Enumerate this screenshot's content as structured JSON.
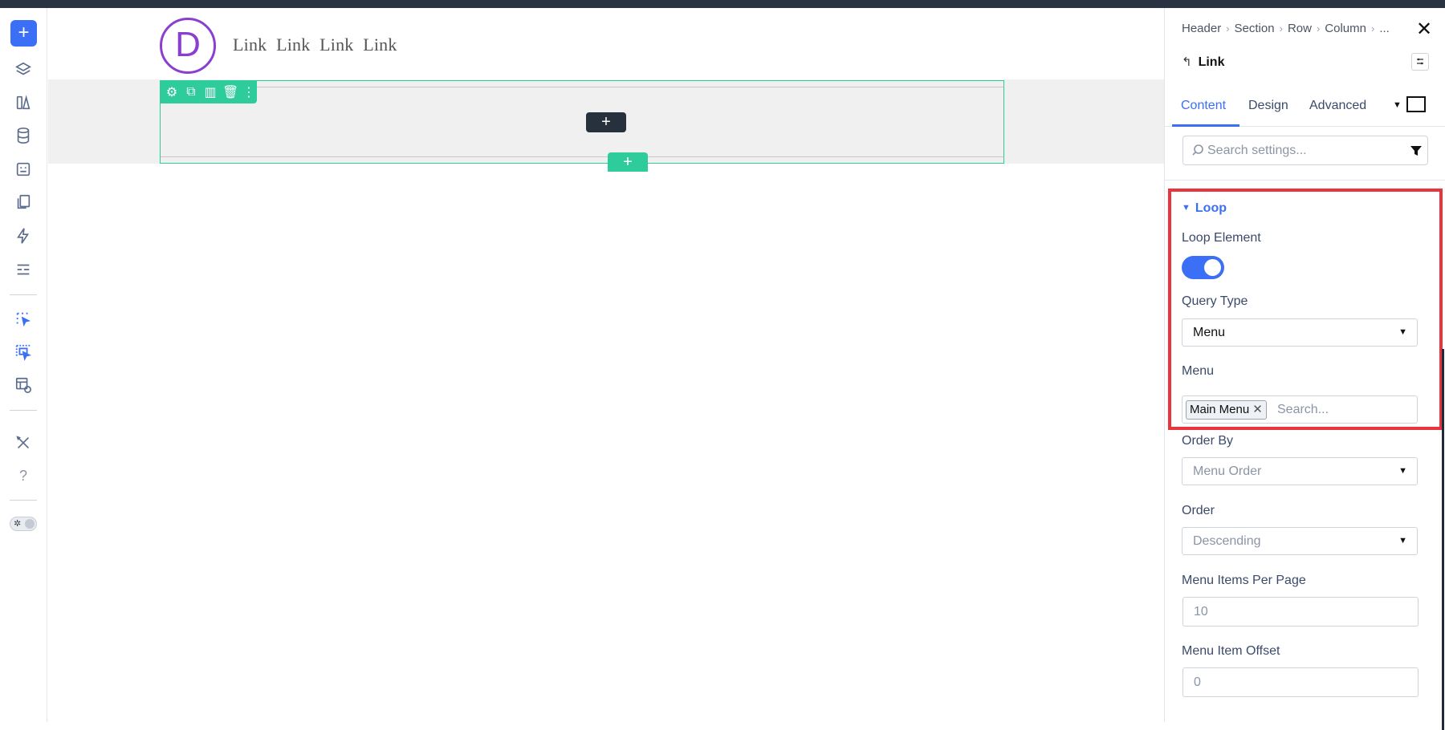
{
  "sidebar": {
    "add_label": "+",
    "items": [
      {
        "icon": "layers-icon"
      },
      {
        "icon": "library-icon"
      },
      {
        "icon": "database-icon"
      },
      {
        "icon": "form-icon"
      },
      {
        "icon": "pages-icon"
      },
      {
        "icon": "lightning-icon"
      },
      {
        "icon": "list-icon"
      },
      {
        "icon": "select-element-icon"
      },
      {
        "icon": "select-multiple-icon"
      },
      {
        "icon": "layout-preview-icon"
      },
      {
        "icon": "tools-icon"
      },
      {
        "icon": "help-icon",
        "label": "?"
      },
      {
        "icon": "theme-toggle-icon"
      }
    ]
  },
  "canvas": {
    "logo_letter": "D",
    "nav_links": [
      "Link",
      "Link",
      "Link",
      "Link"
    ],
    "add_module_label": "+",
    "add_row_label": "+"
  },
  "panel": {
    "breadcrumb": [
      "Header",
      "Section",
      "Row",
      "Column",
      "..."
    ],
    "close_label": "✕",
    "back_label": "↰",
    "title": "Link",
    "tabs": [
      {
        "label": "Content",
        "active": true
      },
      {
        "label": "Design",
        "active": false
      },
      {
        "label": "Advanced",
        "active": false
      }
    ],
    "search_placeholder": "Search settings...",
    "section": {
      "title": "Loop",
      "loop_element_label": "Loop Element",
      "loop_element_on": true,
      "query_type_label": "Query Type",
      "query_type_value": "Menu",
      "menu_label": "Menu",
      "menu_tag": "Main Menu",
      "menu_search_placeholder": "Search..."
    },
    "order_by_label": "Order By",
    "order_by_value": "Menu Order",
    "order_label": "Order",
    "order_value": "Descending",
    "per_page_label": "Menu Items Per Page",
    "per_page_value": "10",
    "offset_label": "Menu Item Offset",
    "offset_value": "0"
  },
  "colors": {
    "accent": "#3b6ff5",
    "row_green": "#2ecc9a",
    "highlight_red": "#e8343c",
    "logo_purple": "#8a3fd1",
    "topbar": "#2a3342"
  }
}
